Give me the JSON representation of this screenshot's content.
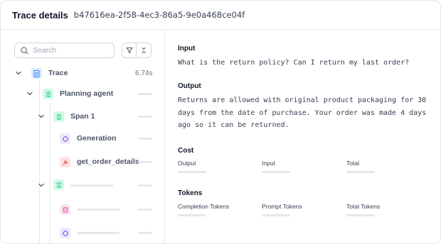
{
  "header": {
    "title": "Trace details",
    "trace_id": "b47616ea-2f58-4ec3-86a5-9e0a468ce04f"
  },
  "sidebar": {
    "search_placeholder": "Search",
    "filter_icon": "filter-icon",
    "collapse_icon": "collapse-all-icon",
    "tree": [
      {
        "label": "Trace",
        "duration": "6.74s",
        "icon": "trace-document-icon",
        "color": "#3b82f6"
      },
      {
        "label": "Planning agent",
        "icon": "agent-icon",
        "color": "#10b981"
      },
      {
        "label": "Span 1",
        "icon": "span-icon",
        "color": "#10b981"
      },
      {
        "label": "Generation",
        "icon": "generation-icon",
        "color": "#8b5cf6"
      },
      {
        "label": "get_order_details",
        "icon": "tool-icon",
        "color": "#ef4444"
      }
    ]
  },
  "details": {
    "input_title": "Input",
    "input_text": "What is the return policy? Can I return my last order?",
    "output_title": "Output",
    "output_text": "Returns are allowed with original product packaging for 30 days from the date of purchase. Your order was made 4 days ago so it can be returned.",
    "cost_title": "Cost",
    "cost_labels": [
      "Output",
      "Input",
      "Total"
    ],
    "tokens_title": "Tokens",
    "token_labels": [
      "Completion Tokens",
      "Prompt Tokens",
      "Total Tokens"
    ]
  }
}
